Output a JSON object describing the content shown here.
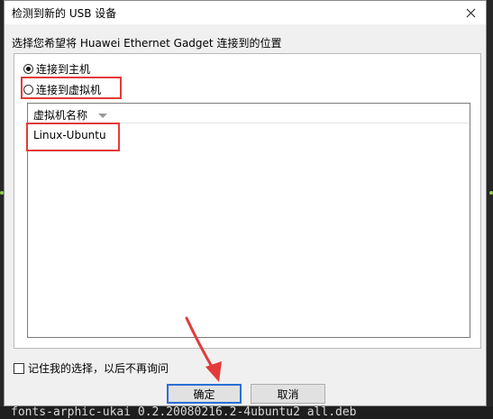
{
  "dialog": {
    "title": "检测到新的 USB 设备",
    "prompt": "选择您希望将 Huawei Ethernet Gadget 连接到的位置",
    "options": [
      {
        "label": "连接到主机",
        "selected": true
      },
      {
        "label": "连接到虚拟机",
        "selected": false
      }
    ],
    "vm_list": {
      "column_header": "虚拟机名称",
      "rows": [
        "Linux-Ubuntu"
      ]
    },
    "remember_label": "记住我的选择，以后不再询问",
    "ok_label": "确定",
    "cancel_label": "取消"
  },
  "background": {
    "terminal_text": "fonts-arphic-ukai 0.2.20080216.2-4ubuntu2 all.deb"
  },
  "colors": {
    "annotation_red": "#e43a3a",
    "default_button_border": "#2a6fd6"
  }
}
